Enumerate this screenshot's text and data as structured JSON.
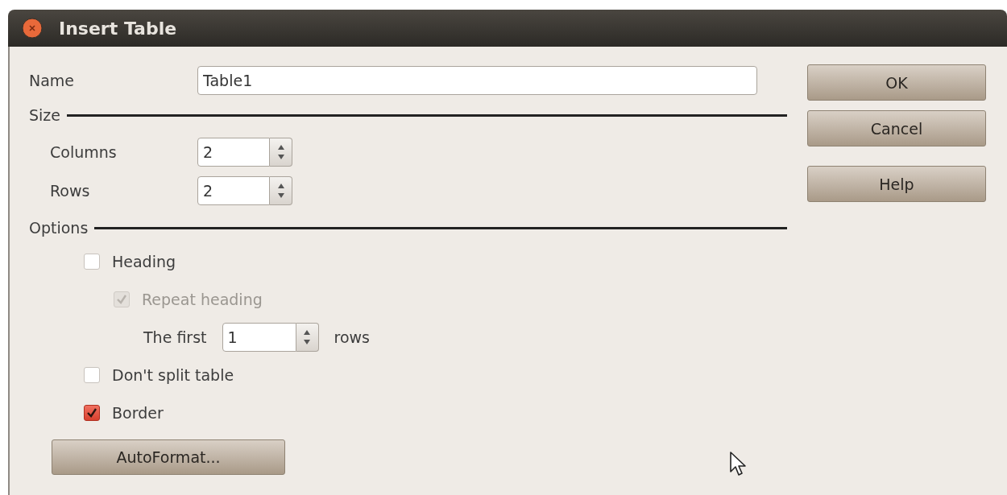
{
  "window": {
    "title": "Insert Table"
  },
  "name": {
    "label": "Name",
    "value": "Table1"
  },
  "size": {
    "title": "Size",
    "fields": [
      {
        "label": "Columns",
        "value": "2"
      },
      {
        "label": "Rows",
        "value": "2"
      }
    ]
  },
  "options": {
    "title": "Options",
    "items": [
      {
        "kind": "checkbox",
        "label": "Heading",
        "checked": false,
        "disabled": false,
        "children": [
          {
            "kind": "checkbox",
            "label": "Repeat heading",
            "checked": true,
            "disabled": true,
            "children": [
              {
                "kind": "spin",
                "label": "The first",
                "value": "1",
                "unit": "rows"
              }
            ]
          }
        ]
      },
      {
        "kind": "checkbox",
        "label": "Don't split table",
        "checked": false,
        "disabled": false
      },
      {
        "kind": "checkbox",
        "label": "Border",
        "checked": true,
        "disabled": false
      }
    ]
  },
  "autoformat_button": "AutoFormat...",
  "buttons": [
    "OK",
    "Cancel",
    "Help"
  ]
}
